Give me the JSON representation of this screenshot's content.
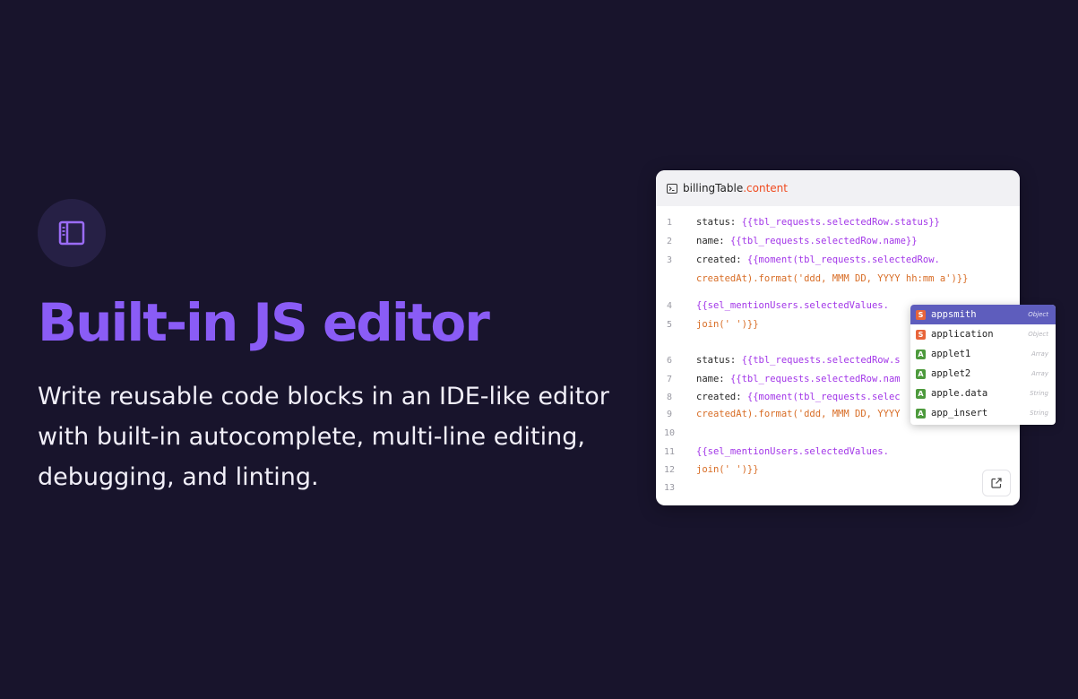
{
  "hero": {
    "icon": "sidebar-panel-icon",
    "headline": "Built-in JS editor",
    "description": "Write reusable code blocks in an IDE-like editor with built-in autocomplete, multi-line editing, debugging, and linting."
  },
  "editor": {
    "title_object": "billingTable",
    "title_property": ".content",
    "header_icon": "terminal-icon",
    "open_icon": "external-link-icon",
    "line_numbers": [
      "1",
      "2",
      "3",
      "4",
      "5",
      "6",
      "7",
      "8",
      "9",
      "10",
      "11",
      "12",
      "13"
    ],
    "code": {
      "l1_key": "status: ",
      "l1_expr": "{{tbl_requests.selectedRow.status}}",
      "l2_key": "name: ",
      "l2_expr": "{{tbl_requests.selectedRow.name}}",
      "l3_key": "created: ",
      "l3_expr": "{{moment(tbl_requests.selectedRow.",
      "l3b_code": "createdAt).format('ddd, MMM DD, YYYY hh:mm a')}}",
      "l4_expr": "{{sel_mentionUsers.selectedValues.",
      "l5_code": "join(' ')}}",
      "l6_key": "status: ",
      "l6_expr": "{{tbl_requests.selectedRow.s",
      "l7_key": "name: ",
      "l7_expr": "{{tbl_requests.selectedRow.nam",
      "l8_key": "created: ",
      "l8_expr": "{{moment(tbl_requests.selec",
      "l9_code": "createdAt).format('ddd, MMM DD, YYYY",
      "l11_expr": "{{sel_mentionUsers.selectedValues.",
      "l12_code": "join(' ')}}"
    }
  },
  "autocomplete": {
    "items": [
      {
        "badge": "S",
        "label": "appsmith",
        "type": "Object",
        "color": "#e8643a"
      },
      {
        "badge": "S",
        "label": "application",
        "type": "Object",
        "color": "#e8643a"
      },
      {
        "badge": "A",
        "label": "applet1",
        "type": "Array",
        "color": "#4d9a3c"
      },
      {
        "badge": "A",
        "label": "applet2",
        "type": "Array",
        "color": "#4d9a3c"
      },
      {
        "badge": "A",
        "label": "apple.data",
        "type": "String",
        "color": "#4d9a3c"
      },
      {
        "badge": "A",
        "label": "app_insert",
        "type": "String",
        "color": "#4d9a3c"
      }
    ]
  },
  "colors": {
    "background": "#18142c",
    "headline": "#8a5cf6",
    "accent_selected": "#5e5dbd"
  }
}
